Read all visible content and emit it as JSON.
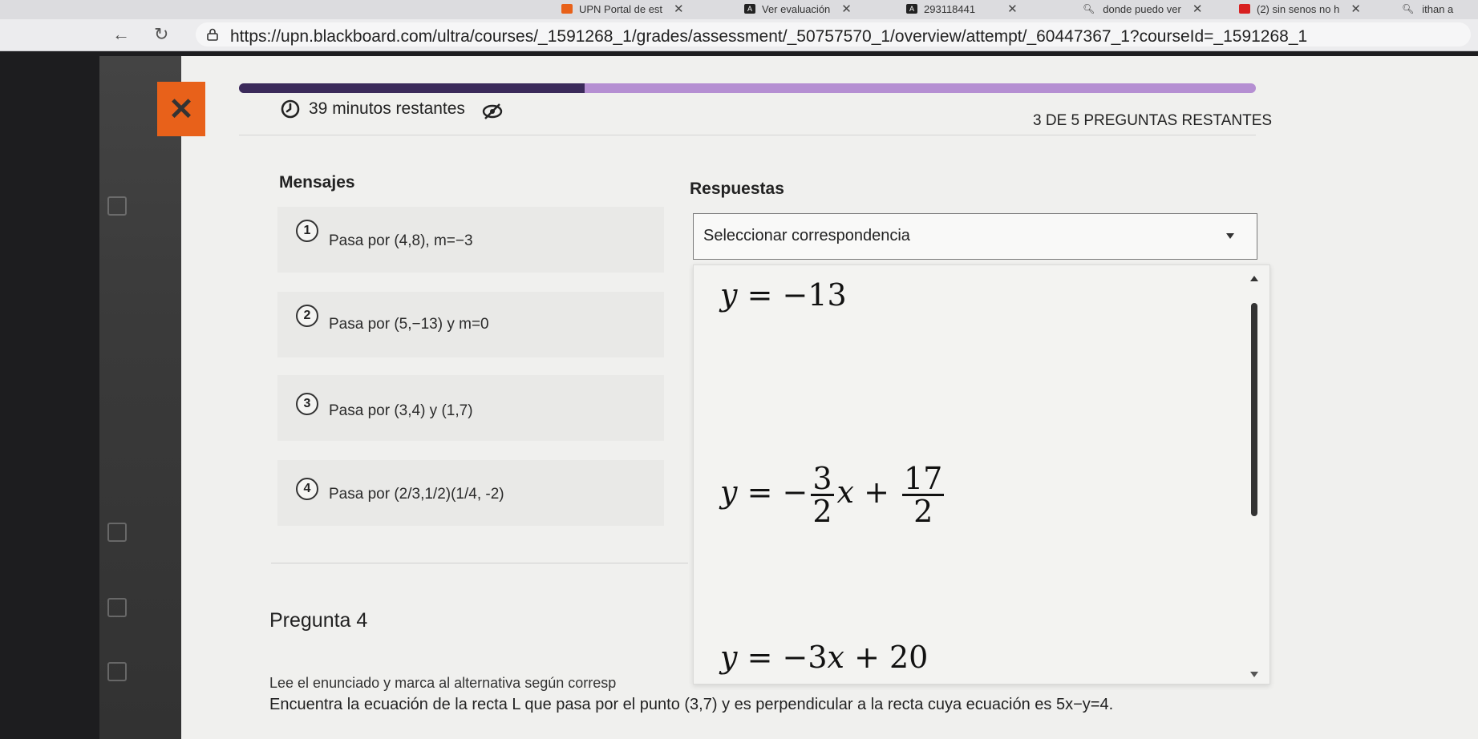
{
  "browser": {
    "tabs": [
      {
        "label": "UPN Portal de est",
        "favicon": "upn"
      },
      {
        "label": "Ver evaluación",
        "favicon": "A"
      },
      {
        "label": "293118441",
        "favicon": "A"
      },
      {
        "label": "donde puedo ver",
        "favicon": "search"
      },
      {
        "label": "(2) sin senos no h",
        "favicon": "video"
      },
      {
        "label": "ithan a",
        "favicon": "search"
      }
    ],
    "url": "https://upn.blackboard.com/ultra/courses/_1591268_1/grades/assessment/_50757570_1/overview/attempt/_60447367_1?courseId=_1591268_1"
  },
  "assessment": {
    "timer": "39 minutos restantes",
    "remaining": "3 DE 5 PREGUNTAS RESTANTES",
    "progress_fraction": 0.34
  },
  "matching": {
    "messages_header": "Mensajes",
    "answers_header": "Respuestas",
    "items": [
      {
        "num": "1",
        "text": "Pasa por (4,8), m=−3"
      },
      {
        "num": "2",
        "text": "Pasa por (5,−13) y m=0"
      },
      {
        "num": "3",
        "text": "Pasa por (3,4) y (1,7)"
      },
      {
        "num": "4",
        "text": "Pasa por (2/3,1/2)(1/4, -2)"
      }
    ],
    "select_placeholder": "Seleccionar correspondencia",
    "options": [
      {
        "lhs": "y",
        "eq": "=",
        "rhs": "−13"
      },
      {
        "lhs": "y",
        "eq": "=",
        "sign": "−",
        "frac1_num": "3",
        "frac1_den": "2",
        "var": "x",
        "op": "+",
        "frac2_num": "17",
        "frac2_den": "2"
      },
      {
        "lhs": "y",
        "eq": "=",
        "rhs_a": "−3",
        "var": "x",
        "op": "+",
        "rhs_b": "20"
      }
    ]
  },
  "question": {
    "title": "Pregunta 4",
    "instruction": "Lee el enunciado y marca al alternativa según corresp",
    "body": "Encuentra la ecuación de la recta L que pasa por el punto (3,7) y es perpendicular a la recta cuya ecuación es 5x−y=4."
  },
  "colors": {
    "close_button": "#e8611a",
    "progress_fill": "#3b2a5a",
    "progress_track": "#b58fd2"
  }
}
